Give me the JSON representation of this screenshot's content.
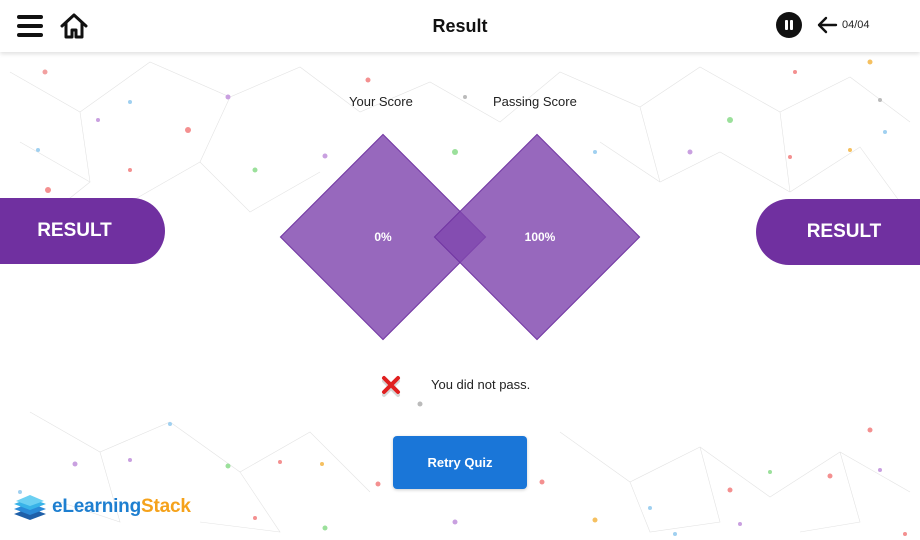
{
  "header": {
    "title": "Result",
    "page_counter": "04/04",
    "icons": [
      "menu-icon",
      "home-icon",
      "pause-icon",
      "arrow-left-icon"
    ]
  },
  "side_tabs": {
    "left_label": "RESULT",
    "right_label": "RESULT"
  },
  "scores": {
    "your_score_label": "Your Score",
    "your_score_value": "0%",
    "passing_score_label": "Passing Score",
    "passing_score_value": "100%"
  },
  "status": {
    "icon": "cross-icon",
    "message": "You did not pass."
  },
  "actions": {
    "retry_label": "Retry Quiz"
  },
  "branding": {
    "logo_part1": "eLearning",
    "logo_part2": "Stack"
  },
  "colors": {
    "accent_purple": "#7030a0",
    "diamond_purple": "#8047af",
    "button_blue": "#1a76d8",
    "fail_red": "#e02020",
    "logo_blue": "#1e7fd0",
    "logo_orange": "#f5a21b"
  }
}
